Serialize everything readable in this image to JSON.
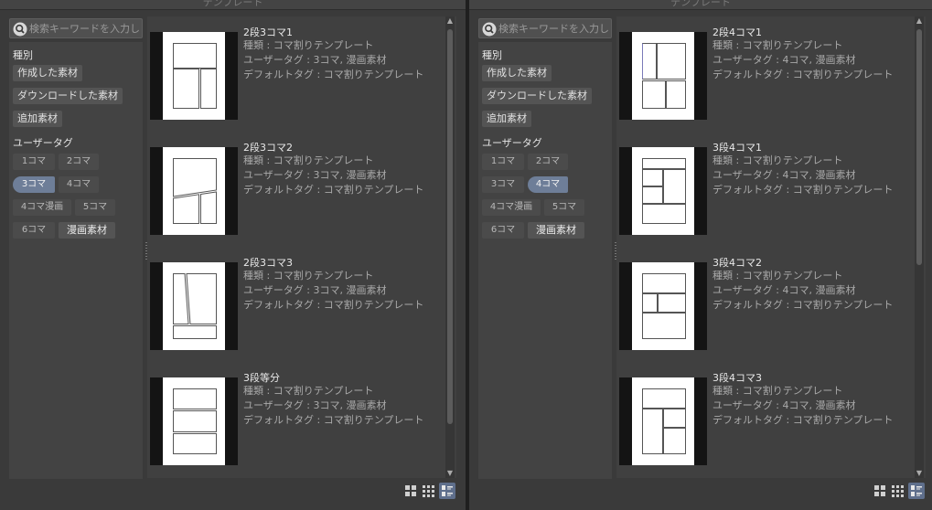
{
  "window_title": "テンプレート",
  "left": {
    "search_placeholder": "検索キーワードを入力し...",
    "kind_label": "種別",
    "kind_buttons": [
      "作成した素材",
      "ダウンロードした素材",
      "追加素材"
    ],
    "tag_label": "ユーザータグ",
    "tags": [
      "1コマ",
      "2コマ",
      "3コマ",
      "4コマ",
      "4コマ漫画",
      "5コマ",
      "6コマ",
      "漫画素材"
    ],
    "selected_tag": "3コマ",
    "items": [
      {
        "name": "2段3コマ1",
        "kind": "種類 : コマ割りテンプレート",
        "user_tag": "ユーザータグ : 3コマ, 漫画素材",
        "default_tag": "デフォルトタグ : コマ割りテンプレート"
      },
      {
        "name": "2段3コマ2",
        "kind": "種類 : コマ割りテンプレート",
        "user_tag": "ユーザータグ : 3コマ, 漫画素材",
        "default_tag": "デフォルトタグ : コマ割りテンプレート"
      },
      {
        "name": "2段3コマ3",
        "kind": "種類 : コマ割りテンプレート",
        "user_tag": "ユーザータグ : 3コマ, 漫画素材",
        "default_tag": "デフォルトタグ : コマ割りテンプレート"
      },
      {
        "name": "3段等分",
        "kind": "種類 : コマ割りテンプレート",
        "user_tag": "ユーザータグ : 3コマ, 漫画素材",
        "default_tag": "デフォルトタグ : コマ割りテンプレート"
      }
    ]
  },
  "right": {
    "search_placeholder": "検索キーワードを入力し...",
    "kind_label": "種別",
    "kind_buttons": [
      "作成した素材",
      "ダウンロードした素材",
      "追加素材"
    ],
    "tag_label": "ユーザータグ",
    "tags": [
      "1コマ",
      "2コマ",
      "3コマ",
      "4コマ",
      "4コマ漫画",
      "5コマ",
      "6コマ",
      "漫画素材"
    ],
    "selected_tag": "4コマ",
    "items": [
      {
        "name": "2段4コマ1",
        "kind": "種類 : コマ割りテンプレート",
        "user_tag": "ユーザータグ : 4コマ, 漫画素材",
        "default_tag": "デフォルトタグ : コマ割りテンプレート"
      },
      {
        "name": "3段4コマ1",
        "kind": "種類 : コマ割りテンプレート",
        "user_tag": "ユーザータグ : 4コマ, 漫画素材",
        "default_tag": "デフォルトタグ : コマ割りテンプレート"
      },
      {
        "name": "3段4コマ2",
        "kind": "種類 : コマ割りテンプレート",
        "user_tag": "ユーザータグ : 4コマ, 漫画素材",
        "default_tag": "デフォルトタグ : コマ割りテンプレート"
      },
      {
        "name": "3段4コマ3",
        "kind": "種類 : コマ割りテンプレート",
        "user_tag": "ユーザータグ : 4コマ, 漫画素材",
        "default_tag": "デフォルトタグ : コマ割りテンプレート"
      }
    ]
  },
  "view_buttons": [
    "large-thumbnail-view-icon",
    "small-thumbnail-view-icon",
    "list-view-icon"
  ],
  "active_view": "list-view-icon",
  "colors": {
    "selected_tag": "#6e7e98",
    "active_view": "#5f6f8c",
    "panel": "#3a3a3a"
  }
}
